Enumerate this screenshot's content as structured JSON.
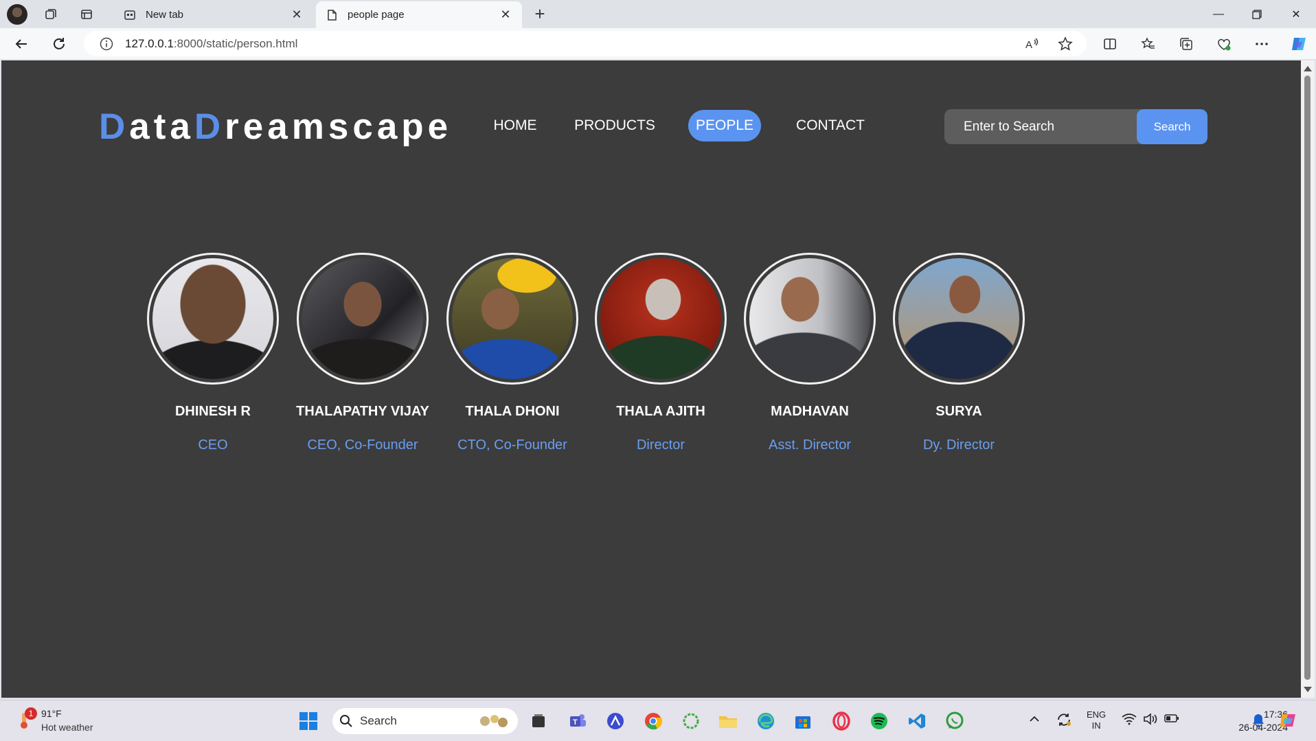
{
  "browser": {
    "tabs": [
      {
        "label": "New tab",
        "active": false
      },
      {
        "label": "people page",
        "active": true
      }
    ],
    "url": {
      "host": "127.0.0.1",
      "rest": ":8000/static/person.html"
    }
  },
  "site": {
    "logo": {
      "letter1": "D",
      "part1": "ata",
      "letter2": "D",
      "part2": "reamscape"
    },
    "nav": [
      "HOME",
      "PRODUCTS",
      "PEOPLE",
      "CONTACT"
    ],
    "active_nav": "PEOPLE",
    "search": {
      "placeholder": "Enter to Search",
      "button": "Search"
    },
    "colors": {
      "accent": "#5b94f0",
      "background": "#3c3c3c",
      "role_text": "#6a9ef0"
    }
  },
  "people": [
    {
      "name": "DHINESH R",
      "role": "CEO"
    },
    {
      "name": "THALAPATHY VIJAY",
      "role": "CEO, Co-Founder"
    },
    {
      "name": "THALA DHONI",
      "role": "CTO, Co-Founder"
    },
    {
      "name": "THALA AJITH",
      "role": "Director"
    },
    {
      "name": "MADHAVAN",
      "role": "Asst. Director"
    },
    {
      "name": "SURYA",
      "role": "Dy. Director"
    }
  ],
  "taskbar": {
    "weather": {
      "temp": "91°F",
      "desc": "Hot weather",
      "badge": "1"
    },
    "search_label": "Search",
    "language": {
      "line1": "ENG",
      "line2": "IN"
    },
    "time": "17:36",
    "date": "26-04-2024"
  }
}
